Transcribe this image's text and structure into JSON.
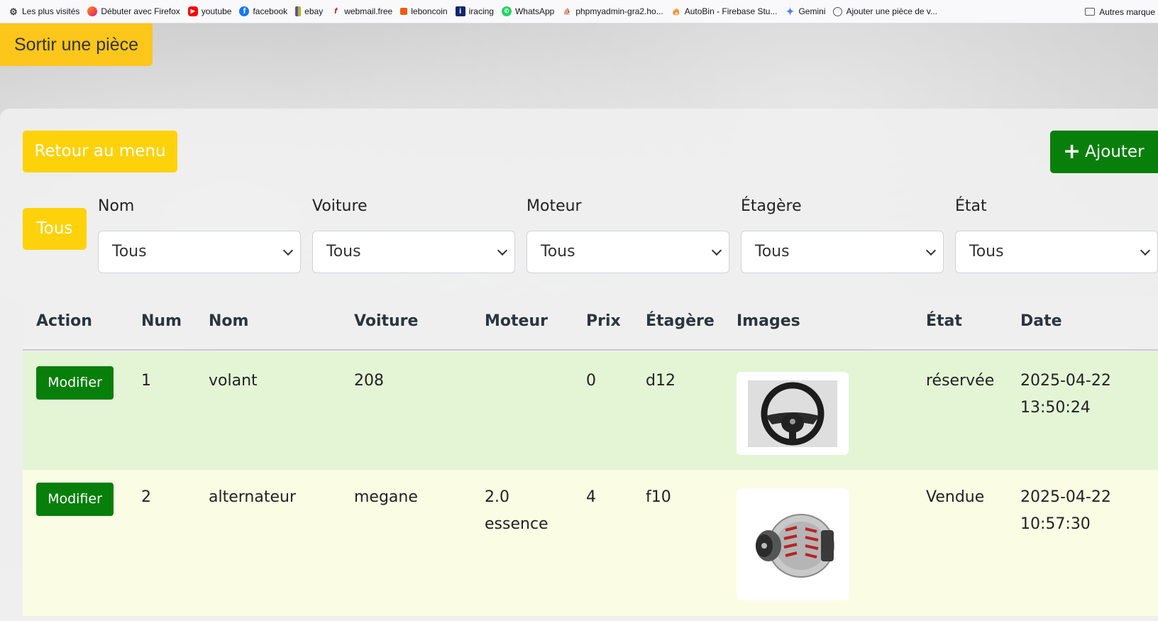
{
  "bookmarks": [
    {
      "label": "Les plus visités",
      "icon": "gear-icon"
    },
    {
      "label": "Débuter avec Firefox",
      "icon": "firefox-icon"
    },
    {
      "label": "youtube",
      "icon": "youtube-icon"
    },
    {
      "label": "facebook",
      "icon": "facebook-icon"
    },
    {
      "label": "ebay",
      "icon": "ebay-icon"
    },
    {
      "label": "webmail.free",
      "icon": "free-icon"
    },
    {
      "label": "leboncoin",
      "icon": "leboncoin-icon"
    },
    {
      "label": "iracing",
      "icon": "iracing-icon"
    },
    {
      "label": "WhatsApp",
      "icon": "whatsapp-icon"
    },
    {
      "label": "phpmyadmin-gra2.ho...",
      "icon": "phpmyadmin-icon"
    },
    {
      "label": "AutoBin - Firebase Stu...",
      "icon": "firebase-icon"
    },
    {
      "label": "Gemini",
      "icon": "gemini-icon"
    },
    {
      "label": "Ajouter une pièce de v...",
      "icon": "globe-icon"
    }
  ],
  "bookmarks_other": "Autres marque",
  "top_button": "Sortir une pièce",
  "retour_button": "Retour au menu",
  "ajouter_button": "Ajouter",
  "tous_button": "Tous",
  "filters": [
    {
      "label": "Nom",
      "value": "Tous"
    },
    {
      "label": "Voiture",
      "value": "Tous"
    },
    {
      "label": "Moteur",
      "value": "Tous"
    },
    {
      "label": "Étagère",
      "value": "Tous"
    },
    {
      "label": "État",
      "value": "Tous"
    }
  ],
  "table": {
    "headers": [
      "Action",
      "Num",
      "Nom",
      "Voiture",
      "Moteur",
      "Prix",
      "Étagère",
      "Images",
      "État",
      "Date"
    ],
    "rows": [
      {
        "action": "Modifier",
        "num": "1",
        "nom": "volant",
        "voiture": "208",
        "moteur": "",
        "prix": "0",
        "etagere": "d12",
        "image": "steering-wheel",
        "etat": "réservée",
        "date": "2025-04-22",
        "time": "13:50:24"
      },
      {
        "action": "Modifier",
        "num": "2",
        "nom": "alternateur",
        "voiture": "megane",
        "moteur_line1": "2.0",
        "moteur_line2": "essence",
        "prix": "4",
        "etagere": "f10",
        "image": "alternator",
        "etat": "Vendue",
        "date": "2025-04-22",
        "time": "10:57:30"
      }
    ]
  },
  "colors": {
    "yellow": "#fed20a",
    "green": "#087f0b",
    "row_reserved": "#e4f5d6",
    "row_sold": "#fbfce4"
  }
}
